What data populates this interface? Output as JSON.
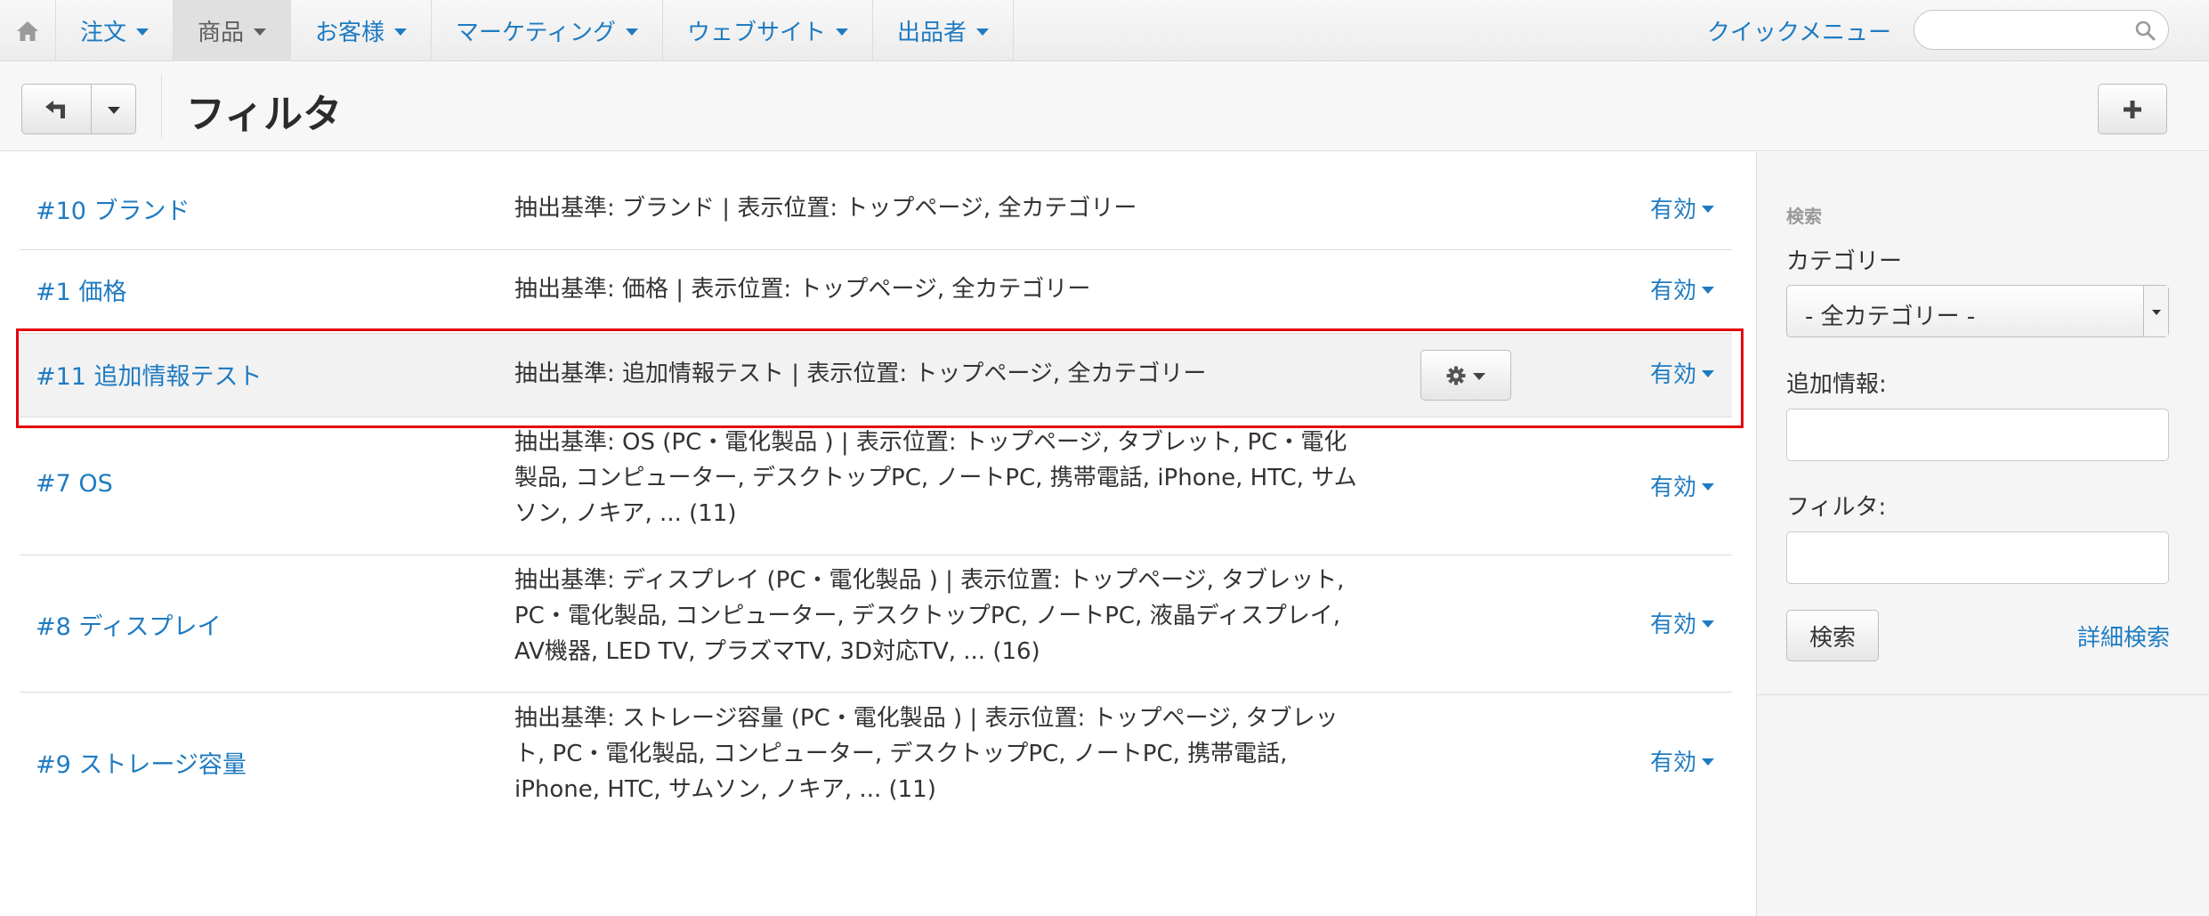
{
  "topnav": {
    "menu": [
      {
        "label": "注文",
        "active": false
      },
      {
        "label": "商品",
        "active": true
      },
      {
        "label": "お客様",
        "active": false
      },
      {
        "label": "マーケティング",
        "active": false
      },
      {
        "label": "ウェブサイト",
        "active": false
      },
      {
        "label": "出品者",
        "active": false
      }
    ],
    "quick_menu": "クイックメニュー",
    "search_value": ""
  },
  "header": {
    "title": "フィルタ"
  },
  "filters": [
    {
      "name": "#10 ブランド",
      "desc": [
        "抽出基準: ブランド | 表示位置: トップページ, 全カテゴリー"
      ],
      "status": "有効"
    },
    {
      "name": "#1 価格",
      "desc": [
        "抽出基準: 価格 | 表示位置: トップページ, 全カテゴリー"
      ],
      "status": "有効"
    },
    {
      "name": "#11 追加情報テスト",
      "desc": [
        "抽出基準: 追加情報テスト | 表示位置: トップページ, 全カテゴリー"
      ],
      "status": "有効",
      "highlighted": true
    },
    {
      "name": "#7 OS",
      "desc": [
        "抽出基準: OS (PC・電化製品 ) | 表示位置: トップページ, タブレット, PC・電化",
        "製品, コンピューター, デスクトップPC, ノートPC, 携帯電話, iPhone, HTC, サム",
        "ソン, ノキア, ... (11)"
      ],
      "status": "有効"
    },
    {
      "name": "#8 ディスプレイ",
      "desc": [
        "抽出基準: ディスプレイ (PC・電化製品 ) | 表示位置: トップページ, タブレット,",
        "PC・電化製品, コンピューター, デスクトップPC, ノートPC, 液晶ディスプレイ,",
        "AV機器, LED TV, プラズマTV, 3D対応TV, ... (16)"
      ],
      "status": "有効"
    },
    {
      "name": "#9 ストレージ容量",
      "desc": [
        "抽出基準: ストレージ容量 (PC・電化製品 ) | 表示位置: トップページ, タブレッ",
        "ト, PC・電化製品, コンピューター, デスクトップPC, ノートPC, 携帯電話,",
        "iPhone, HTC, サムソン, ノキア, ... (11)"
      ],
      "status": "有効"
    }
  ],
  "sidebar": {
    "heading": "検索",
    "category_label": "カテゴリー",
    "category_value": "- 全カテゴリー -",
    "extra_label": "追加情報:",
    "extra_value": "",
    "filter_label": "フィルタ:",
    "filter_value": "",
    "search_button": "検索",
    "advanced_link": "詳細検索"
  },
  "colors": {
    "link": "#1f7bc1",
    "highlight_border": "#e3000b",
    "row_highlight_bg": "#f2f2f2"
  }
}
